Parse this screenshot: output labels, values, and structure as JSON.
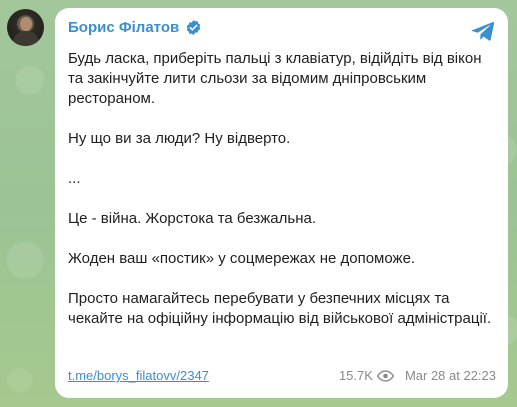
{
  "channel": {
    "name": "Борис Філатов"
  },
  "post": {
    "paragraphs": [
      "Будь ласка, приберіть пальці з клавіатур, відійдіть від вікон та закінчуйте лити сльози за відомим дніпровським рестораном.",
      "Ну що ви за люди? Ну відверто.",
      "...",
      "Це - війна. Жорстока та безжальна.",
      "Жоден ваш «постик» у соцмережах не допоможе.",
      "Просто намагайтесь перебувати у безпечних місцях та чекайте на офіційну інформацію від військової адміністрації."
    ],
    "link": "t.me/borys_filatovv/2347",
    "views": "15.7K",
    "timestamp": "Mar 28 at 22:23"
  },
  "icons": {
    "verified": "verified-badge-icon",
    "share": "telegram-share-icon",
    "views": "eye-icon"
  },
  "colors": {
    "accent": "#3a8fcf",
    "background": "#9fc49a",
    "bubble": "#ffffff",
    "meta": "#8a8a8a"
  }
}
